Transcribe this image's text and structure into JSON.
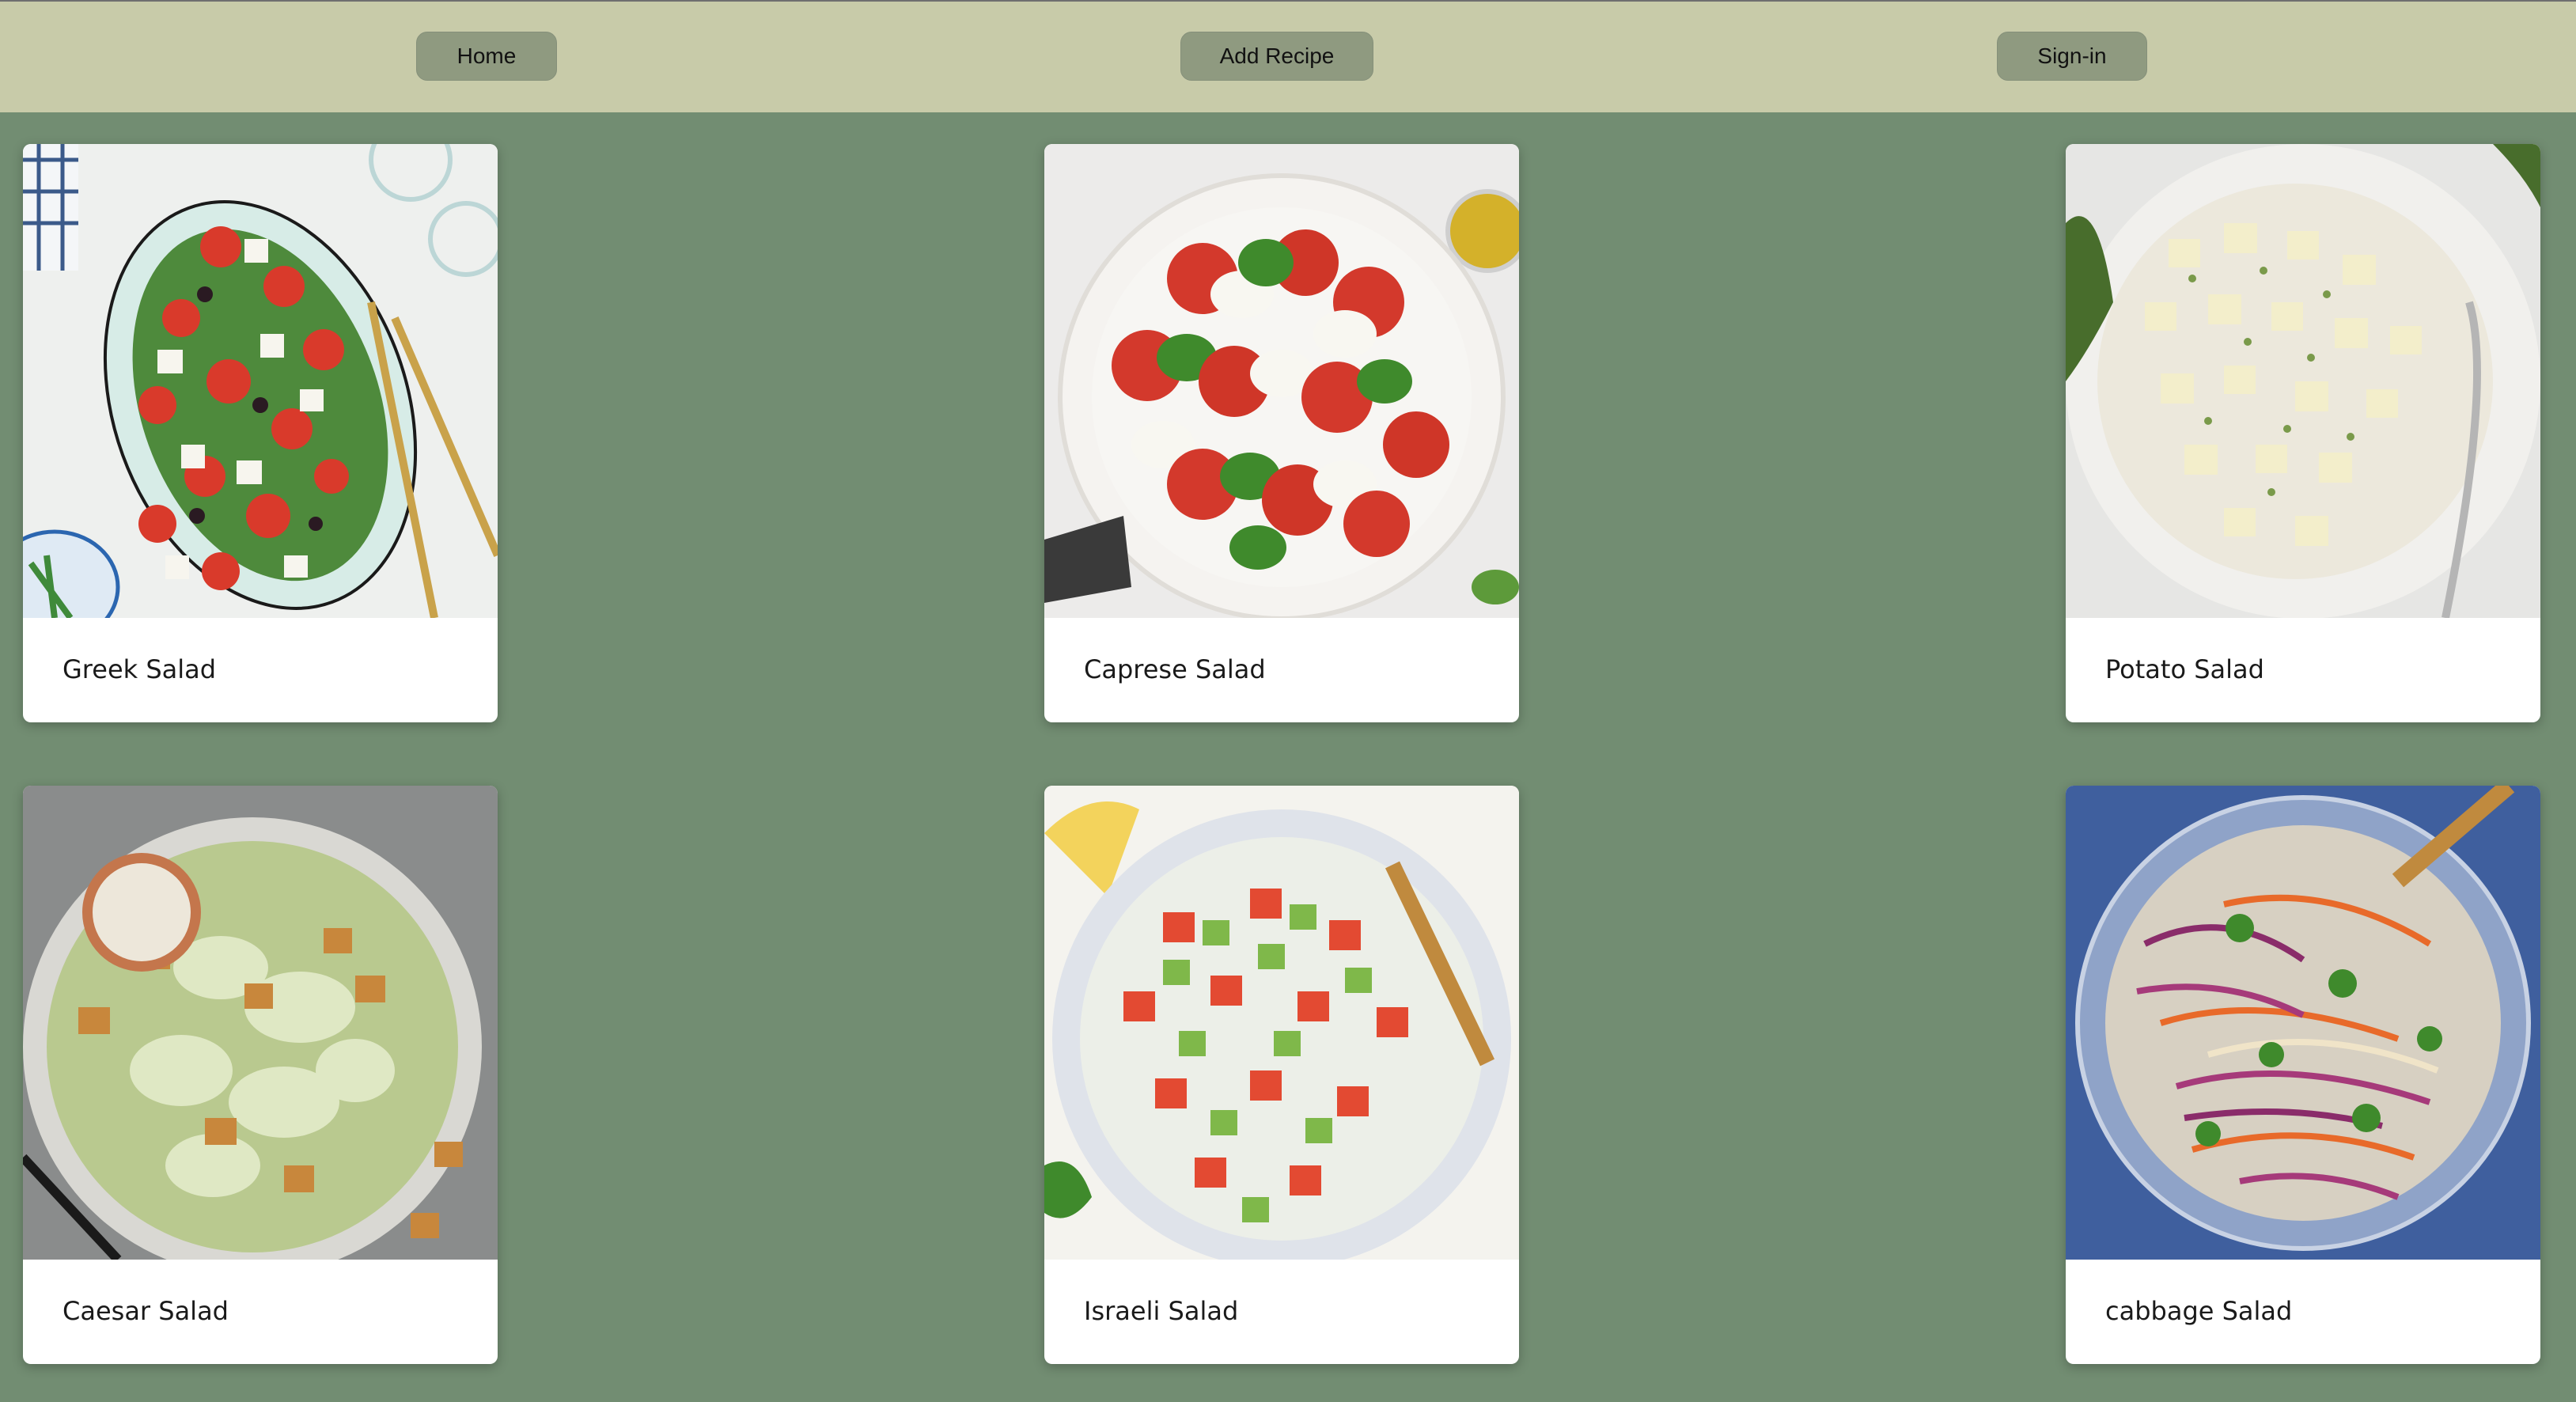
{
  "nav": {
    "home_label": "Home",
    "add_recipe_label": "Add Recipe",
    "signin_label": "Sign-in"
  },
  "recipes": [
    {
      "title": "Greek Salad",
      "image": "greek-salad-photo"
    },
    {
      "title": "Caprese Salad",
      "image": "caprese-salad-photo"
    },
    {
      "title": "Potato Salad",
      "image": "potato-salad-photo"
    },
    {
      "title": "Caesar Salad",
      "image": "caesar-salad-photo"
    },
    {
      "title": "Israeli Salad",
      "image": "israeli-salad-photo"
    },
    {
      "title": "cabbage Salad",
      "image": "cabbage-salad-photo"
    }
  ],
  "colors": {
    "page_background": "#728d72",
    "navbar_background": "#c8cba9",
    "nav_button": "#8f9a80",
    "card_background": "#ffffff"
  }
}
